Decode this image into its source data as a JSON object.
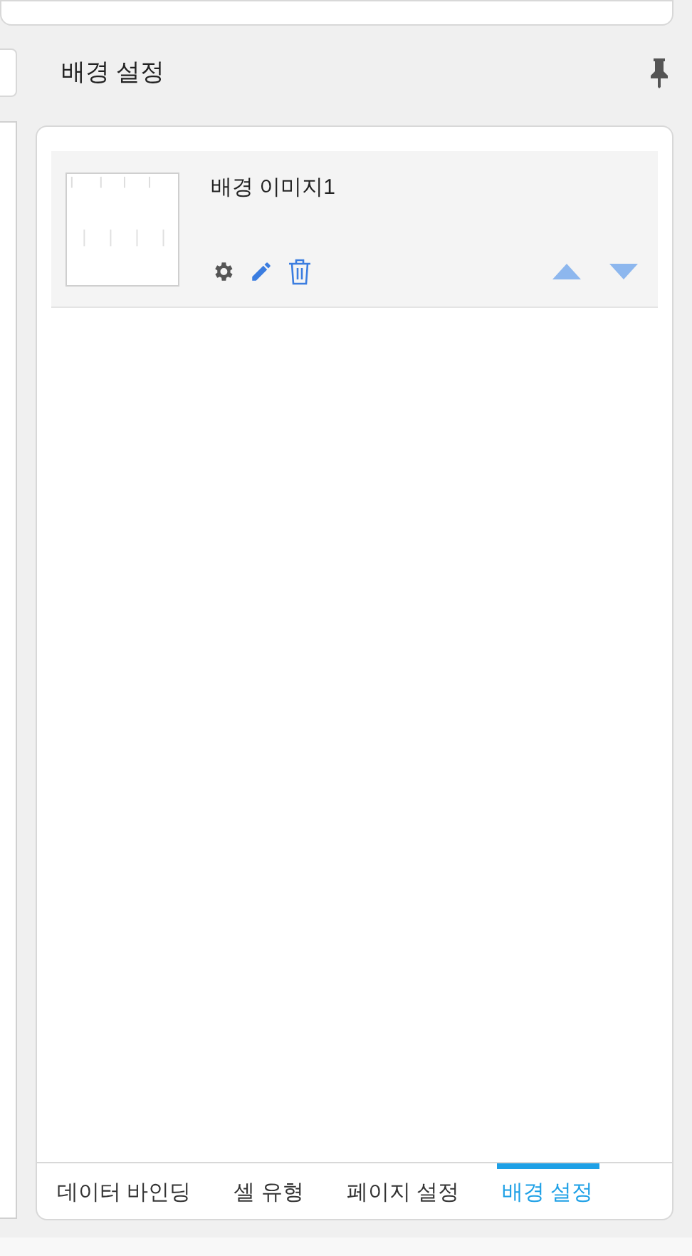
{
  "panel": {
    "title": "배경 설정",
    "pinned": true
  },
  "images": [
    {
      "name": "배경 이미지1"
    }
  ],
  "tabs": [
    {
      "label": "데이터 바인딩",
      "selected": false
    },
    {
      "label": "셀 유형",
      "selected": false
    },
    {
      "label": "페이지 설정",
      "selected": false
    },
    {
      "label": "배경 설정",
      "selected": true
    }
  ]
}
